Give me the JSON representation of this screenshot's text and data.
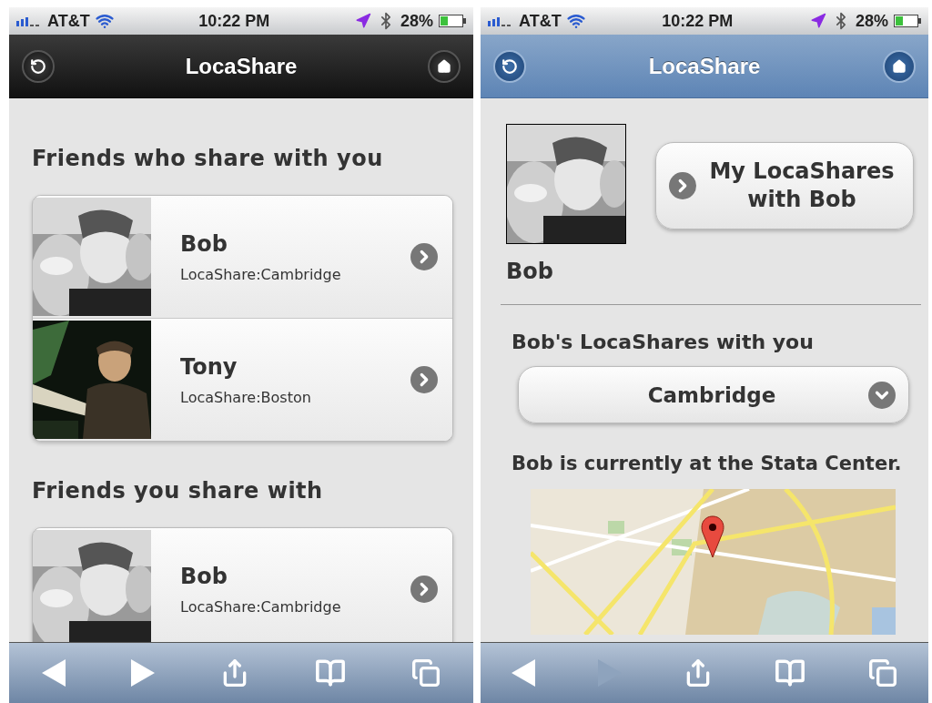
{
  "screens": [
    {
      "kind": "list",
      "status_bar": {
        "carrier": "AT&T",
        "time": "10:22 PM",
        "battery": "28%"
      },
      "nav": {
        "title": "LocaShare"
      },
      "sections": [
        {
          "heading": "Friends who share with you",
          "rows": [
            {
              "name": "Bob",
              "subtitle": "LocaShare:Cambridge"
            },
            {
              "name": "Tony",
              "subtitle": "LocaShare:Boston"
            }
          ]
        },
        {
          "heading": "Friends you share with",
          "rows": [
            {
              "name": "Bob",
              "subtitle": "LocaShare:Cambridge"
            }
          ]
        }
      ],
      "toolbar": [
        {
          "disabled": false
        },
        {
          "disabled": false
        },
        {
          "disabled": false
        },
        {
          "disabled": false
        },
        {
          "disabled": false
        }
      ]
    },
    {
      "kind": "detail",
      "status_bar": {
        "carrier": "AT&T",
        "time": "10:22 PM",
        "battery": "28%"
      },
      "nav": {
        "title": "LocaShare"
      },
      "profile": {
        "name": "Bob"
      },
      "action_button": "My LocaShares with Bob",
      "shares_heading": "Bob's LocaShares with you",
      "select": {
        "value": "Cambridge"
      },
      "status_text": "Bob is currently at the Stata Center.",
      "toolbar": [
        {
          "disabled": false
        },
        {
          "disabled": true
        },
        {
          "disabled": false
        },
        {
          "disabled": false
        },
        {
          "disabled": false
        }
      ]
    }
  ]
}
